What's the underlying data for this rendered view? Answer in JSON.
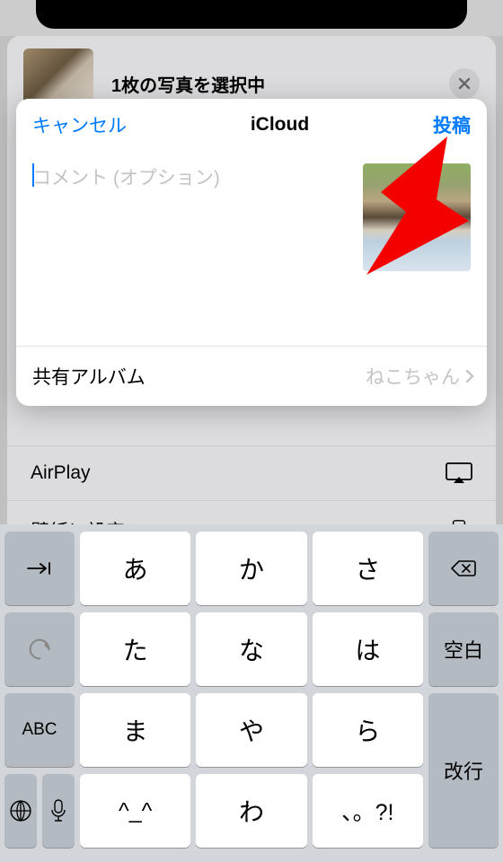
{
  "share": {
    "title": "1枚の写真を選択中"
  },
  "modal": {
    "cancel": "キャンセル",
    "title": "iCloud",
    "post": "投稿",
    "placeholder": "コメント (オプション)",
    "row_label": "共有アルバム",
    "row_value": "ねこちゃん"
  },
  "bg_rows": {
    "airplay": "AirPlay",
    "wallpaper": "壁紙に設定"
  },
  "keys": {
    "a": "あ",
    "ka": "か",
    "sa": "さ",
    "ta": "た",
    "na": "な",
    "ha": "は",
    "ma": "ま",
    "ya": "や",
    "ra": "ら",
    "face": "^_^",
    "wa": "わ",
    "punct": "、。?!",
    "space": "空白",
    "enter": "改行",
    "abc": "ABC"
  }
}
